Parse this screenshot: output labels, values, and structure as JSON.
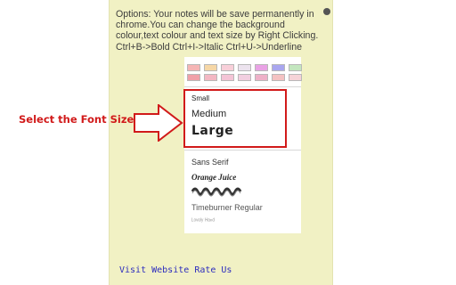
{
  "note": {
    "options_text": "Options: Your notes will be save permanently in chrome.You can change the background colour,text colour and text size by Right Clicking. Ctrl+B->Bold Ctrl+I->Italic Ctrl+U->Underline"
  },
  "palette": {
    "row1": [
      "#f5b5b5",
      "#f6d7a6",
      "#f8cfd9",
      "#ece3ee",
      "#e9a2e5",
      "#a9a6ef",
      "#c3e6bf"
    ],
    "row2": [
      "#f0a0a8",
      "#f3b7c3",
      "#f4c4d6",
      "#f2cfe0",
      "#eeb1c8",
      "#f4c2c2",
      "#f6d3d8"
    ]
  },
  "font_sizes": {
    "small": "Small",
    "medium": "Medium",
    "large": "Large"
  },
  "fonts": {
    "sans_serif": "Sans Serif",
    "orange_juice": "Orange Juice",
    "decorative": "",
    "timeburner": "Timeburner Regular",
    "script": "ᴸᵒᵛᵉˡʸ ᴴᵃⁿᵈ"
  },
  "annotation": {
    "label": "Select the Font Size",
    "color": "#d11a1a"
  },
  "footer": {
    "visit": "Visit Website",
    "rate": "Rate Us"
  }
}
